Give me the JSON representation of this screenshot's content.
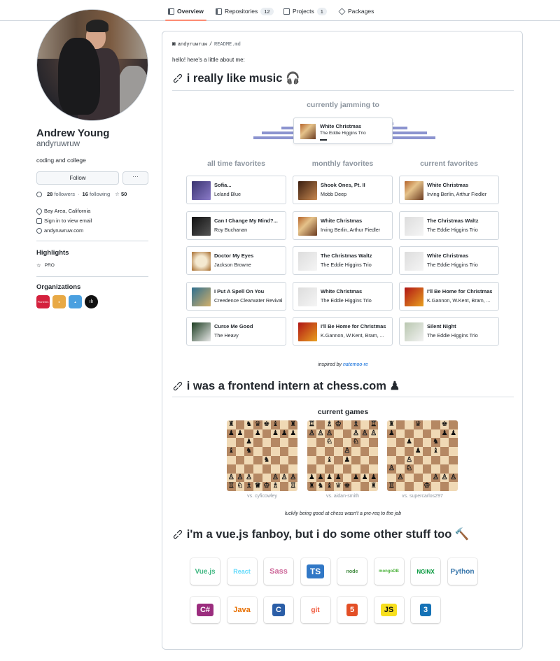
{
  "nav": {
    "tabs": [
      {
        "label": "Overview",
        "count": ""
      },
      {
        "label": "Repositories",
        "count": "12"
      },
      {
        "label": "Projects",
        "count": "1"
      },
      {
        "label": "Packages",
        "count": ""
      }
    ]
  },
  "profile": {
    "name": "Andrew Young",
    "login": "andyruwruw",
    "bio": "coding and college",
    "follow_label": "Follow",
    "more_label": "···",
    "followers": "28",
    "followers_label": "followers",
    "sep": "·",
    "following": "16",
    "following_label": "following",
    "stars": "50",
    "location": "Bay Area, California",
    "email": "Sign in to view email",
    "website": "andyruwruw.com",
    "highlights_title": "Highlights",
    "highlight_pro": "PRO",
    "orgs_title": "Organizations",
    "orgs": [
      {
        "label": "Pioneers",
        "color": "#d4213d"
      },
      {
        "label": "",
        "color": "#e8a945"
      },
      {
        "label": "",
        "color": "#4aa0e0"
      },
      {
        "label": "",
        "color": "#111111"
      }
    ]
  },
  "readme": {
    "owner": "andyruwruw",
    "slash": "/",
    "file": "README.md",
    "intro": "hello! here's a little about me:",
    "music_heading": "i really like music 🎧",
    "jamming_title": "currently jamming to",
    "now_playing": {
      "title": "White Christmas",
      "artist": "The Eddie Higgins Trio"
    },
    "col_titles": [
      "all time favorites",
      "monthly favorites",
      "current favorites"
    ],
    "all_time": [
      {
        "title": "Sofia...",
        "artist": "Leland Blue"
      },
      {
        "title": "Can I Change My Mind?...",
        "artist": "Roy Buchanan"
      },
      {
        "title": "Doctor My Eyes",
        "artist": "Jackson Browne"
      },
      {
        "title": "I Put A Spell On You",
        "artist": "Creedence Clearwater Revival"
      },
      {
        "title": "Curse Me Good",
        "artist": "The Heavy"
      }
    ],
    "monthly": [
      {
        "title": "Shook Ones, Pt. II",
        "artist": "Mobb Deep"
      },
      {
        "title": "White Christmas",
        "artist": "Irving Berlin, Arthur Fiedler"
      },
      {
        "title": "The Christmas Waltz",
        "artist": "The Eddie Higgins Trio"
      },
      {
        "title": "White Christmas",
        "artist": "The Eddie Higgins Trio"
      },
      {
        "title": "I'll Be Home for Christmas",
        "artist": "K.Gannon, W.Kent, Bram, ..."
      }
    ],
    "current": [
      {
        "title": "White Christmas",
        "artist": "Irving Berlin, Arthur Fiedler"
      },
      {
        "title": "The Christmas Waltz",
        "artist": "The Eddie Higgins Trio"
      },
      {
        "title": "White Christmas",
        "artist": "The Eddie Higgins Trio"
      },
      {
        "title": "I'll Be Home for Christmas",
        "artist": "K.Gannon, W.Kent, Bram, ..."
      },
      {
        "title": "Silent Night",
        "artist": "The Eddie Higgins Trio"
      }
    ],
    "inspired_prefix": "inspired by",
    "inspired_link": "natemoo-re",
    "chess_heading": "i was a frontend intern at chess.com ♟",
    "games_title": "current games",
    "games": [
      {
        "vs": "vs. cyficowley"
      },
      {
        "vs": "vs. aidan-smith"
      },
      {
        "vs": "vs. supercarlos297"
      }
    ],
    "chess_note": "luckily being good at chess wasn't a pre-req to the job",
    "vue_heading": "i'm a vue.js fanboy, but i do some other stuff too 🔨",
    "tech_row1": [
      "Vue.js",
      "React",
      "Sass",
      "TS",
      "node",
      "mongoDB",
      "NGINX",
      "Python"
    ],
    "tech_row2": [
      "C#",
      "Java",
      "C",
      "git",
      "5",
      "JS",
      "3"
    ]
  }
}
